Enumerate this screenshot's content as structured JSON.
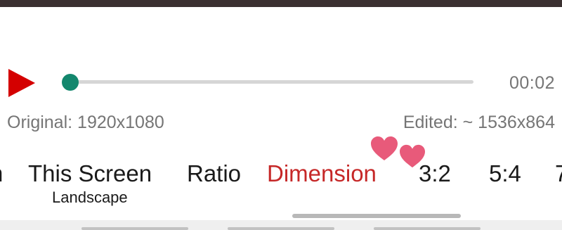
{
  "player": {
    "play_icon": "play-icon",
    "play_color": "#d40000",
    "progress": 0.0,
    "thumb_color": "#13876d",
    "time": "00:02"
  },
  "info": {
    "original": "Original: 1920x1080",
    "edited": "Edited: ~ 1536x864"
  },
  "decorations": {
    "heart_icon": "heart-icon",
    "heart_color": "#e85a7a"
  },
  "tabs": {
    "items": [
      {
        "label": "n"
      },
      {
        "label": "This Screen",
        "sublabel": "Landscape"
      },
      {
        "label": "Ratio"
      },
      {
        "label": "Dimension",
        "active": true
      },
      {
        "label": "3:2"
      },
      {
        "label": "5:4"
      },
      {
        "label": "7"
      }
    ],
    "active_color": "#c62828"
  }
}
